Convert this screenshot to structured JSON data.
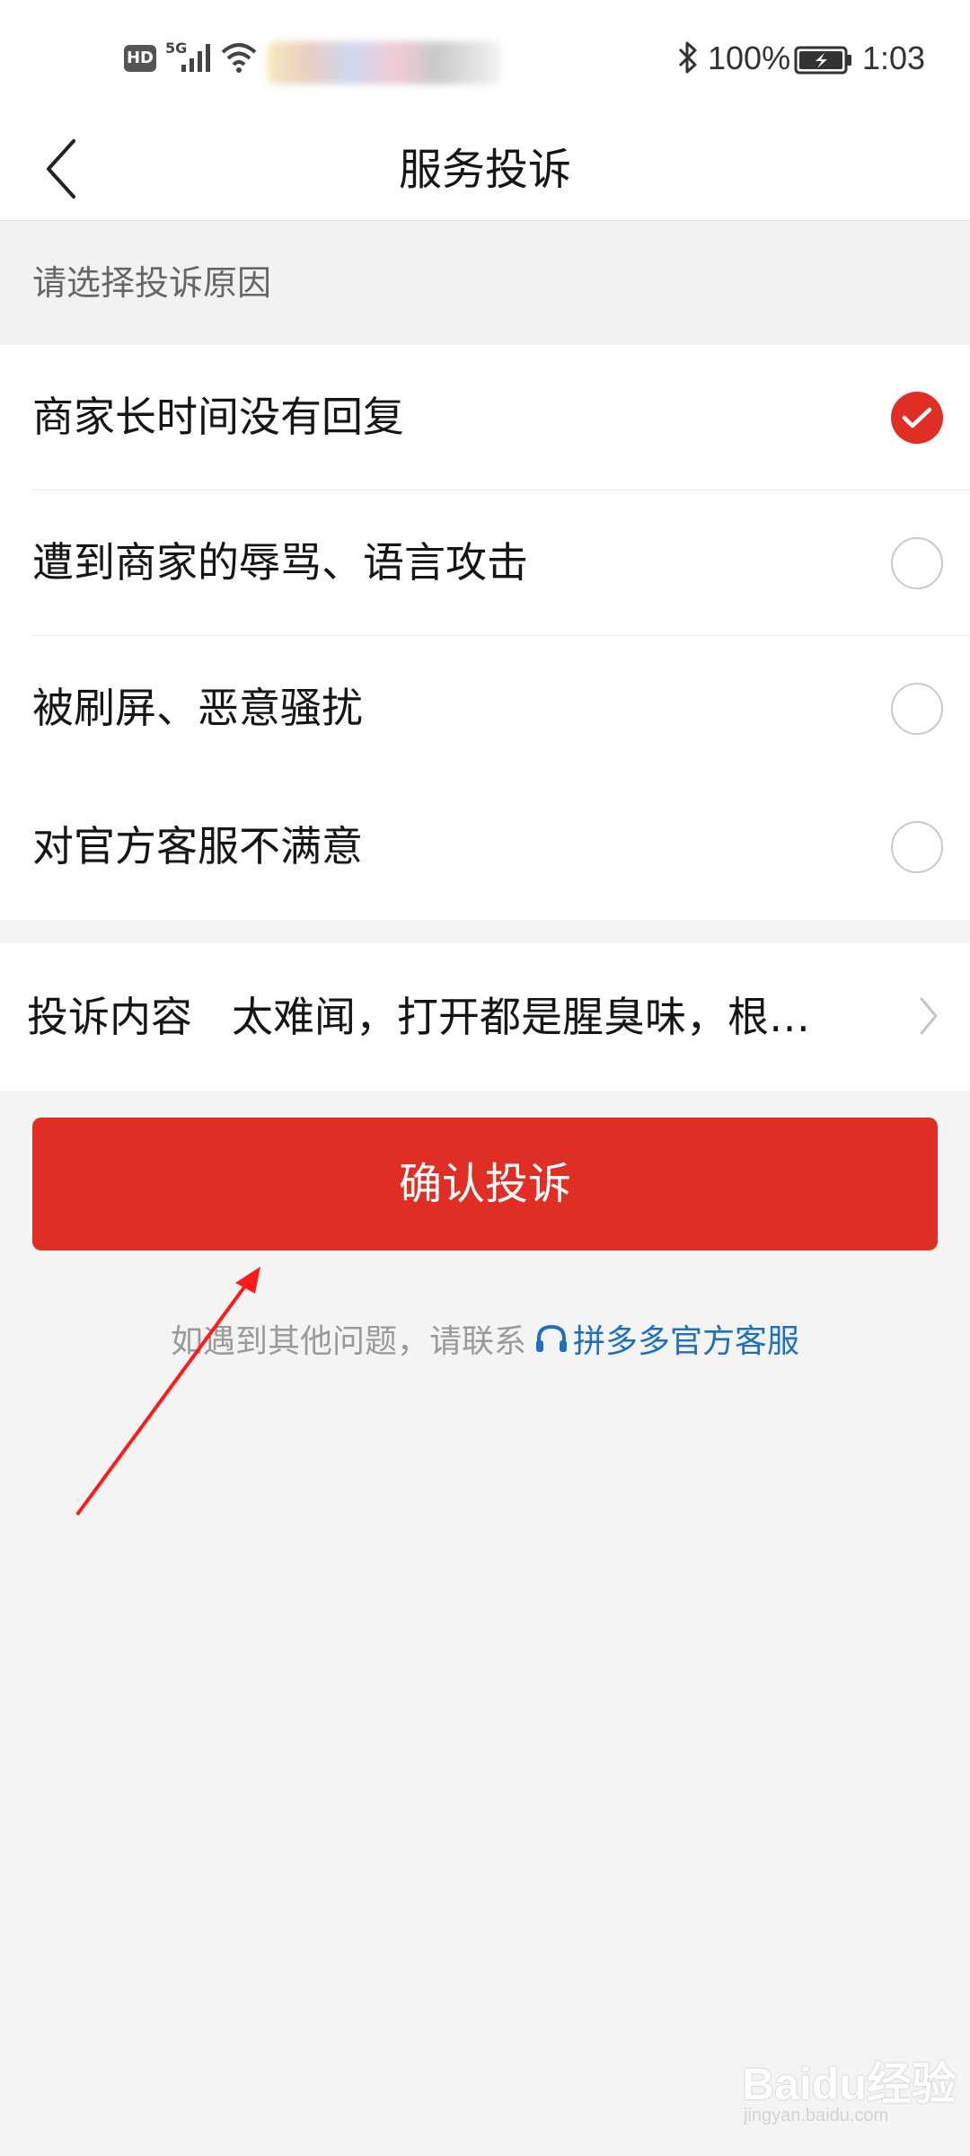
{
  "status_bar": {
    "hd": "HD",
    "network": "5G",
    "battery_percent": "100%",
    "time": "1:03"
  },
  "nav": {
    "title": "服务投诉",
    "back_icon": "chevron-left-icon"
  },
  "section": {
    "header": "请选择投诉原因"
  },
  "reasons": [
    {
      "label": "商家长时间没有回复",
      "checked": true
    },
    {
      "label": "遭到商家的辱骂、语言攻击",
      "checked": false
    },
    {
      "label": "被刷屏、恶意骚扰",
      "checked": false
    },
    {
      "label": "对官方客服不满意",
      "checked": false
    }
  ],
  "content": {
    "label": "投诉内容",
    "value": "太难闻，打开都是腥臭味，根…"
  },
  "confirm_button": {
    "label": "确认投诉"
  },
  "help": {
    "prefix": "如遇到其他问题，请联系",
    "link": "拼多多官方客服",
    "link_icon": "headset-icon"
  },
  "watermark": {
    "logo": "Baidu经验",
    "sub": "jingyan.baidu.com"
  },
  "colors": {
    "accent_red": "#e02e24",
    "link_blue": "#1f6fc1",
    "background": "#f4f4f4"
  }
}
